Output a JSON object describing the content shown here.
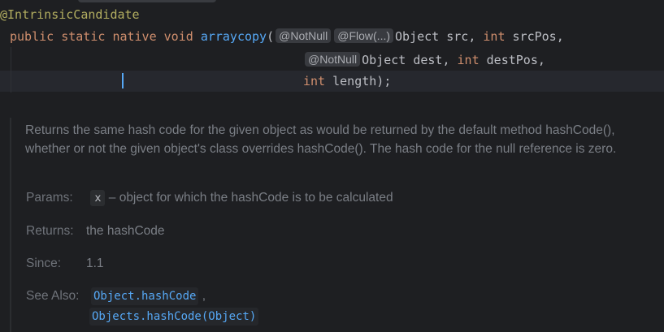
{
  "code": {
    "annotation": "@IntrinsicCandidate",
    "kw_public": "public",
    "kw_static": "static",
    "kw_native": "native",
    "kw_void": "void",
    "method_name": "arraycopy",
    "open_paren": "(",
    "hint_notnull_1": "@NotNull",
    "hint_flow": "@Flow(...)",
    "type_object_1": "Object",
    "param_src": "src,",
    "kw_int_1": "int",
    "param_srcpos": "srcPos,",
    "hint_notnull_2": "@NotNull",
    "type_object_2": "Object",
    "param_dest": "dest,",
    "kw_int_2": "int",
    "param_destpos": "destPos,",
    "kw_int_3": "int",
    "param_length": "length);"
  },
  "doc": {
    "description": "Returns the same hash code for the given object as would be returned by the default method hashCode(), whether or not the given object's class overrides hashCode(). The hash code for the null reference is zero.",
    "params_label": "Params:",
    "param_name": "x",
    "param_desc": "– object for which the hashCode is to be calculated",
    "returns_label": "Returns:",
    "returns_value": "the hashCode",
    "since_label": "Since:",
    "since_value": "1.1",
    "see_also_label": "See Also:",
    "see_also_1": "Object.hashCode",
    "see_also_sep": ",",
    "see_also_2": "Objects.hashCode(Object)"
  },
  "colors": {
    "background": "#1e1f22",
    "keyword": "#cf8e6d",
    "annotation": "#b3ae60",
    "method": "#56a8f5",
    "doc_text": "#7a7e85",
    "link": "#56a8f5"
  }
}
